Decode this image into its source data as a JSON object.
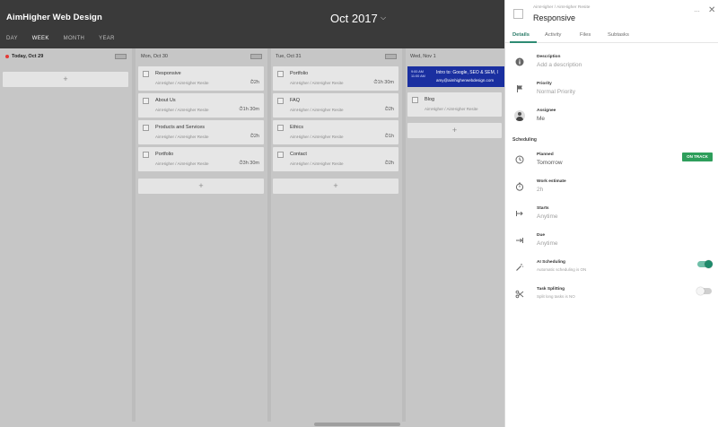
{
  "header": {
    "app_title": "AimHigher Web Design",
    "month": "Oct 2017",
    "views": [
      "DAY",
      "WEEK",
      "MONTH",
      "YEAR"
    ],
    "active_view": "WEEK"
  },
  "columns": [
    {
      "label": "Today, Oct 29",
      "today": true,
      "tasks": []
    },
    {
      "label": "Mon, Oct 30",
      "tasks": [
        {
          "name": "Responsive",
          "project": "AimHigher / AimHigher Resite",
          "duration": "2h"
        },
        {
          "name": "About Us",
          "project": "AimHigher / AimHigher Resite",
          "duration": "1h 30m"
        },
        {
          "name": "Products and Services",
          "project": "AimHigher / AimHigher Resite",
          "duration": "2h"
        },
        {
          "name": "Portfolio",
          "project": "AimHigher / AimHigher Resite",
          "duration": "3h 30m"
        }
      ]
    },
    {
      "label": "Tue, Oct 31",
      "tasks": [
        {
          "name": "Portfolio",
          "project": "AimHigher / AimHigher Resite",
          "duration": "1h 30m"
        },
        {
          "name": "FAQ",
          "project": "AimHigher / AimHigher Resite",
          "duration": "2h"
        },
        {
          "name": "Ethics",
          "project": "AimHigher / AimHigher Resite",
          "duration": "1h"
        },
        {
          "name": "Contact",
          "project": "AimHigher / AimHigher Resite",
          "duration": "2h"
        }
      ]
    },
    {
      "label": "Wed, Nov 1",
      "tasks": [
        {
          "name": "Blog",
          "project": "AimHigher / AimHigher Resite",
          "duration": ""
        }
      ]
    }
  ],
  "event": {
    "time_start": "9:00 AM",
    "time_end": "11:00 AM",
    "title": "Intro to: Google, SEO & SEM, I",
    "email": "amy@aimhigherwebdesign.com"
  },
  "add_symbol": "+",
  "panel": {
    "breadcrumb": "AimHigher / AimHigher Resite",
    "title": "Responsive",
    "more": "···",
    "close": "✕",
    "tabs": [
      "Details",
      "Activity",
      "Files",
      "Subtasks"
    ],
    "active_tab": "Details",
    "description": {
      "label": "Description",
      "value": "Add a description"
    },
    "priority": {
      "label": "Priority",
      "value": "Normal Priority"
    },
    "assignee": {
      "label": "Assignee",
      "value": "Me"
    },
    "scheduling_header": "Scheduling",
    "planned": {
      "label": "Planned",
      "value": "Tomorrow",
      "badge": "ON TRACK"
    },
    "work_estimate": {
      "label": "Work estimate",
      "value": "2h"
    },
    "starts": {
      "label": "Starts",
      "value": "Anytime"
    },
    "due": {
      "label": "Due",
      "value": "Anytime"
    },
    "ai_scheduling": {
      "label": "AI Scheduling",
      "value": "Automatic scheduling is ON",
      "on": true
    },
    "task_splitting": {
      "label": "Task Splitting",
      "value": "Split long tasks is NO",
      "on": false
    }
  },
  "colors": {
    "accent": "#2e8b73",
    "track_badge": "#2e9e5b",
    "event": "#1a2fa0",
    "today_dot": "#e53935"
  }
}
